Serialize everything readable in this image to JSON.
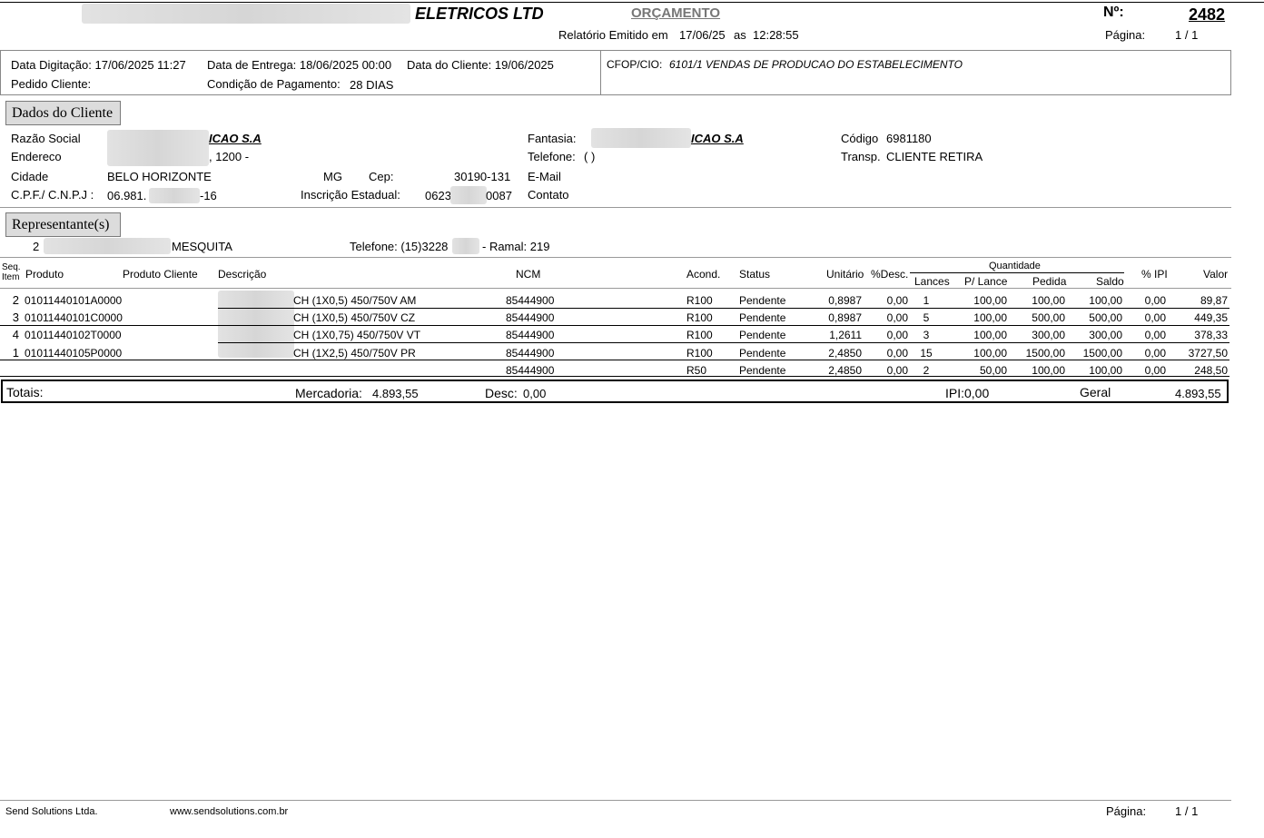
{
  "header": {
    "company": "ELETRICOS LTD",
    "title": "ORÇAMENTO",
    "number_label": "Nº:",
    "number": "2482",
    "emitted_label": "Relatório Emitido em",
    "emitted_date": "17/06/25",
    "emitted_as": "as",
    "emitted_time": "12:28:55",
    "page_label": "Página:",
    "page_value": "1 / 1"
  },
  "info": {
    "data_digitacao": "Data Digitação: 17/06/2025 11:27",
    "data_entrega": "Data de Entrega: 18/06/2025 00:00",
    "data_cliente": "Data do Cliente: 19/06/2025",
    "pedido_cliente": "Pedido Cliente:",
    "condicao_label": "Condição de Pagamento:",
    "condicao_value": "28 DIAS",
    "cfop_label": "CFOP/CIO:",
    "cfop_value": "6101/1 VENDAS DE PRODUCAO DO ESTABELECIMENTO"
  },
  "cliente": {
    "section_title": "Dados do Cliente",
    "razao_label": "Razão Social",
    "razao_value": "ICAO S.A",
    "endereco_label": "Endereco",
    "endereco_value": ", 1200 -",
    "cidade_label": "Cidade",
    "cidade_value": "BELO HORIZONTE",
    "uf": "MG",
    "cep_label": "Cep:",
    "cep_value": "30190-131",
    "cnpj_label": "C.P.F./ C.N.P.J :",
    "cnpj_a": "06.981.",
    "cnpj_b": "-16",
    "ie_label": "Inscrição Estadual:",
    "ie_a": "0623",
    "ie_b": "0087",
    "fantasia_label": "Fantasia:",
    "fantasia_value": "ICAO S.A",
    "telefone_label": "Telefone:",
    "telefone_value": "(          )",
    "email_label": "E-Mail",
    "contato_label": "Contato",
    "codigo_label": "Código",
    "codigo_value": "6981180",
    "transp_label": "Transp.",
    "transp_value": "CLIENTE RETIRA"
  },
  "representante": {
    "section_title": "Representante(s)",
    "code": "2",
    "name": "MESQUITA",
    "telefone": "Telefone: (15)3228",
    "ramal": "- Ramal: 219"
  },
  "table": {
    "headers": {
      "seq1": "Seq.",
      "seq2": "Item",
      "produto": "Produto",
      "produto_cliente": "Produto Cliente",
      "descricao": "Descrição",
      "ncm": "NCM",
      "acond": "Acond.",
      "status": "Status",
      "unitario": "Unitário",
      "desc": "%Desc.",
      "quantidade": "Quantidade",
      "lances": "Lances",
      "p_lance": "P/ Lance",
      "pedida": "Pedida",
      "saldo": "Saldo",
      "ipi": "% IPI",
      "valor": "Valor"
    },
    "rows": [
      {
        "seq": "2",
        "produto": "01011440101A0000",
        "descricao": "CH (1X0,5) 450/750V AM",
        "ncm": "85444900",
        "acond": "R100",
        "status": "Pendente",
        "unitario": "0,8987",
        "desc": "0,00",
        "lances": "1",
        "p_lance": "100,00",
        "pedida": "100,00",
        "saldo": "100,00",
        "ipi": "0,00",
        "valor": "89,87"
      },
      {
        "seq": "3",
        "produto": "01011440101C0000",
        "descricao": "CH (1X0,5) 450/750V CZ",
        "ncm": "85444900",
        "acond": "R100",
        "status": "Pendente",
        "unitario": "0,8987",
        "desc": "0,00",
        "lances": "5",
        "p_lance": "100,00",
        "pedida": "500,00",
        "saldo": "500,00",
        "ipi": "0,00",
        "valor": "449,35"
      },
      {
        "seq": "4",
        "produto": "01011440102T0000",
        "descricao": "CH (1X0,75) 450/750V VT",
        "ncm": "85444900",
        "acond": "R100",
        "status": "Pendente",
        "unitario": "1,2611",
        "desc": "0,00",
        "lances": "3",
        "p_lance": "100,00",
        "pedida": "300,00",
        "saldo": "300,00",
        "ipi": "0,00",
        "valor": "378,33"
      },
      {
        "seq": "1",
        "produto": "01011440105P0000",
        "descricao": "CH (1X2,5) 450/750V PR",
        "ncm": "85444900",
        "acond": "R100",
        "status": "Pendente",
        "unitario": "2,4850",
        "desc": "0,00",
        "lances": "15",
        "p_lance": "100,00",
        "pedida": "1500,00",
        "saldo": "1500,00",
        "ipi": "0,00",
        "valor": "3727,50"
      },
      {
        "seq": "",
        "produto": "",
        "descricao": "",
        "ncm": "85444900",
        "acond": "R50",
        "status": "Pendente",
        "unitario": "2,4850",
        "desc": "0,00",
        "lances": "2",
        "p_lance": "50,00",
        "pedida": "100,00",
        "saldo": "100,00",
        "ipi": "0,00",
        "valor": "248,50"
      }
    ]
  },
  "totais": {
    "label": "Totais:",
    "mercadoria_label": "Mercadoria:",
    "mercadoria_value": "4.893,55",
    "desc_label": "Desc:",
    "desc_value": "0,00",
    "ipi": "IPI:0,00",
    "geral_label": "Geral",
    "geral_value": "4.893,55"
  },
  "footer": {
    "company": "Send Solutions Ltda.",
    "site": "www.sendsolutions.com.br",
    "page_label": "Página:",
    "page_value": "1 / 1"
  }
}
